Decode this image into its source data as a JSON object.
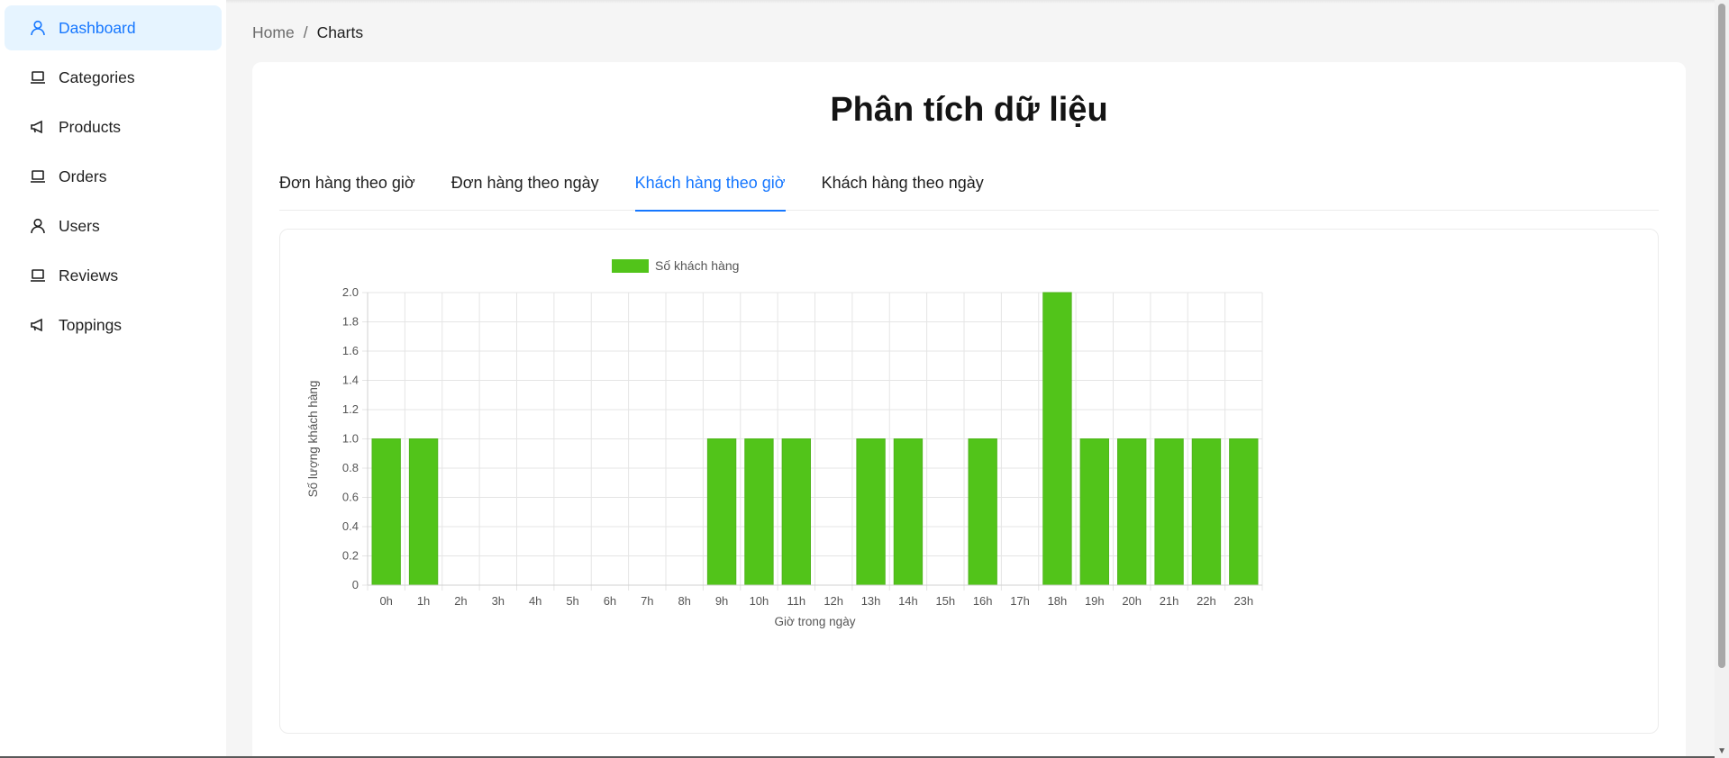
{
  "sidebar": {
    "items": [
      {
        "label": "Dashboard",
        "icon": "user-icon",
        "active": true
      },
      {
        "label": "Categories",
        "icon": "laptop-icon"
      },
      {
        "label": "Products",
        "icon": "megaphone-icon"
      },
      {
        "label": "Orders",
        "icon": "laptop-icon"
      },
      {
        "label": "Users",
        "icon": "user-icon"
      },
      {
        "label": "Reviews",
        "icon": "laptop-icon"
      },
      {
        "label": "Toppings",
        "icon": "megaphone-icon"
      }
    ]
  },
  "breadcrumb": {
    "home": "Home",
    "separator": "/",
    "current": "Charts"
  },
  "page": {
    "title": "Phân tích dữ liệu"
  },
  "tabs": [
    {
      "label": "Đơn hàng theo giờ"
    },
    {
      "label": "Đơn hàng theo ngày"
    },
    {
      "label": "Khách hàng theo giờ",
      "active": true
    },
    {
      "label": "Khách hàng theo ngày"
    }
  ],
  "colors": {
    "accent": "#1677ff",
    "bar": "#52c41a",
    "active_bg": "#e6f4ff"
  },
  "chart_data": {
    "type": "bar",
    "categories": [
      "0h",
      "1h",
      "2h",
      "3h",
      "4h",
      "5h",
      "6h",
      "7h",
      "8h",
      "9h",
      "10h",
      "11h",
      "12h",
      "13h",
      "14h",
      "15h",
      "16h",
      "17h",
      "18h",
      "19h",
      "20h",
      "21h",
      "22h",
      "23h"
    ],
    "series": [
      {
        "name": "Số khách hàng",
        "values": [
          1,
          1,
          0,
          0,
          0,
          0,
          0,
          0,
          0,
          1,
          1,
          1,
          0,
          1,
          1,
          0,
          1,
          0,
          2,
          1,
          1,
          1,
          1,
          1
        ]
      }
    ],
    "xlabel": "Giờ trong ngày",
    "ylabel": "Số lượng khách hàng",
    "ylim": [
      0,
      2
    ],
    "yticks": [
      "0",
      "0.2",
      "0.4",
      "0.6",
      "0.8",
      "1.0",
      "1.2",
      "1.4",
      "1.6",
      "1.8",
      "2.0"
    ],
    "grid": true,
    "legend": "top"
  }
}
